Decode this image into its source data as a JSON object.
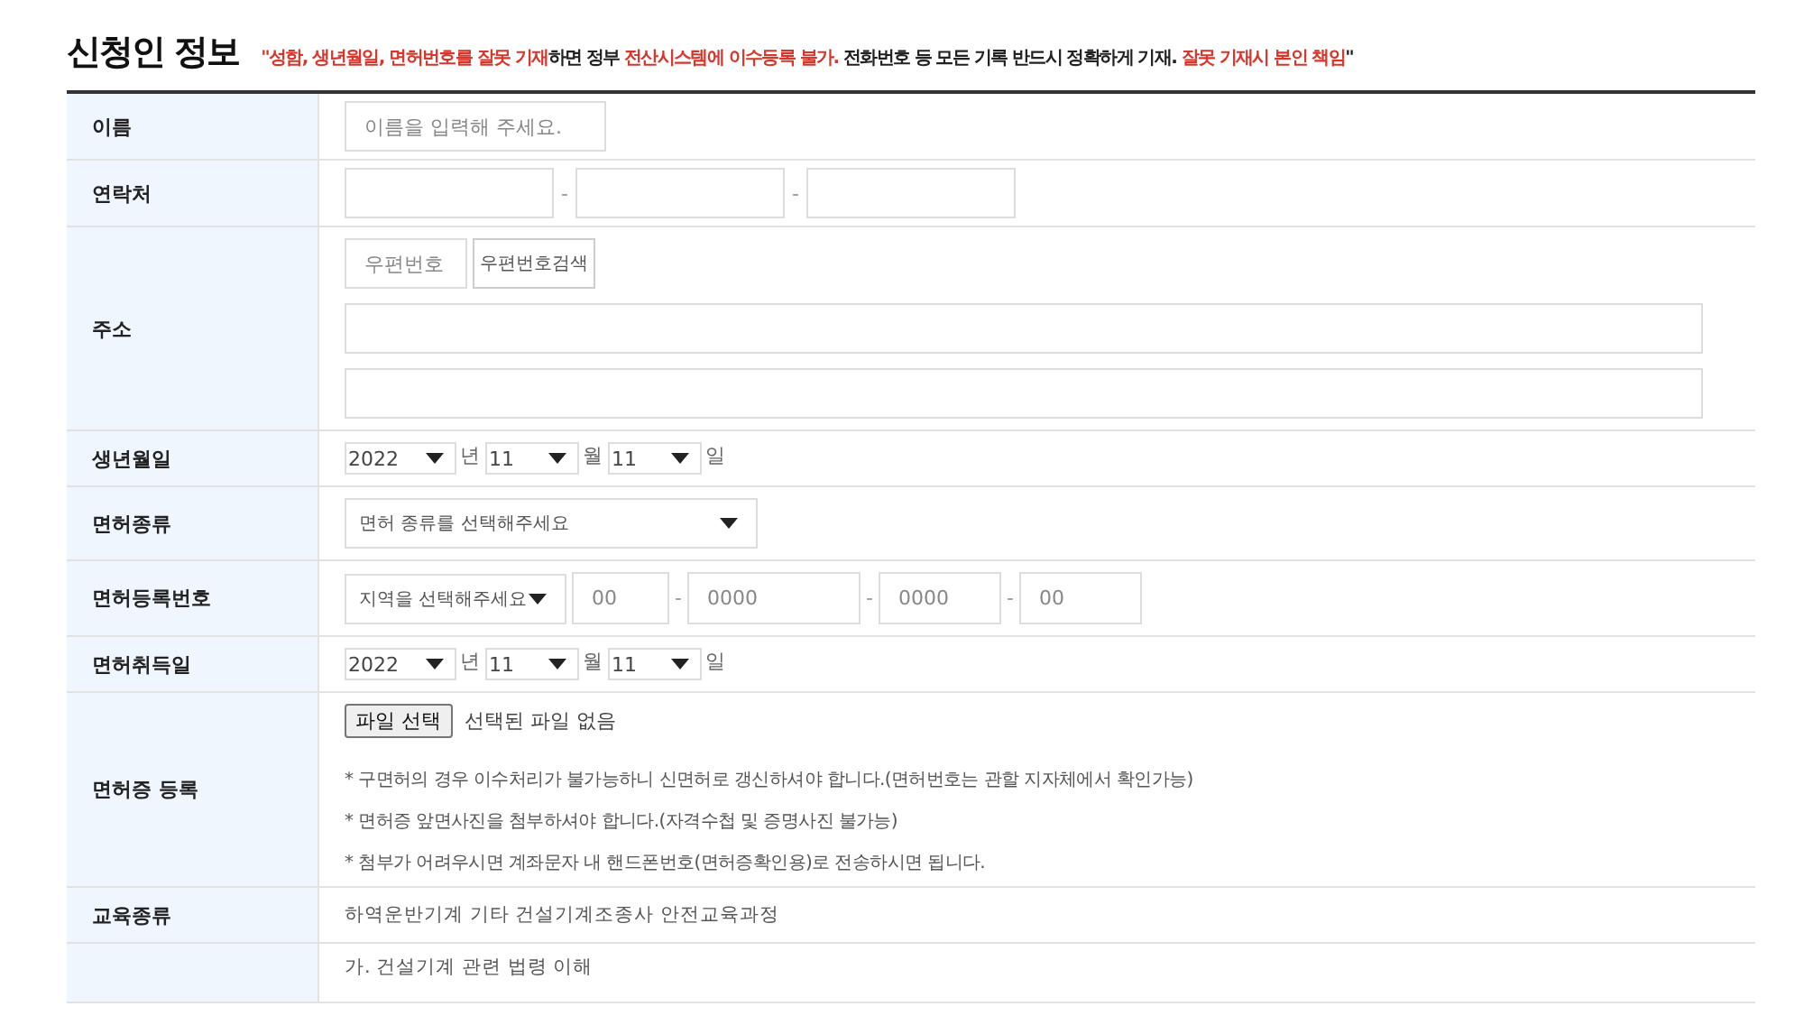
{
  "section": {
    "title": "신청인 정보",
    "notice": [
      {
        "text": "\"성함, 생년월일, 면허번호를 잘못 기재",
        "emphasis": true
      },
      {
        "text": "하면 정부 ",
        "emphasis": false
      },
      {
        "text": "전산시스템에 이수등록 불가.",
        "emphasis": true
      },
      {
        "text": " 전화번호 등 모든 기록 반드시 정확하게 기재. ",
        "emphasis": false
      },
      {
        "text": "잘못 기재시 본인 책임",
        "emphasis": true
      },
      {
        "text": "\"",
        "emphasis": false
      }
    ]
  },
  "rows": [
    {
      "kind": "text",
      "label": "이름",
      "fields": [
        {
          "placeholder": "이름을 입력해 주세요."
        }
      ]
    },
    {
      "kind": "phone",
      "label": "연락처",
      "fields": [
        {
          "kind": "input"
        },
        {
          "kind": "input"
        },
        {
          "kind": "input"
        }
      ],
      "separators": [
        "-",
        "-"
      ]
    },
    {
      "kind": "address",
      "label": "주소",
      "zipcode": {
        "placeholder": "우편번호"
      },
      "search_button": "우편번호검색",
      "lines": [
        {
          "kind": "input"
        },
        {
          "kind": "input"
        }
      ]
    },
    {
      "kind": "date",
      "label": "생년월일",
      "parts": [
        {
          "value": "2022",
          "unit": "년"
        },
        {
          "value": "11",
          "unit": "월"
        },
        {
          "value": "11",
          "unit": "일"
        }
      ]
    },
    {
      "kind": "select",
      "label": "면허종류",
      "value": "면허 종류를 선택해주세요"
    },
    {
      "kind": "license",
      "label": "면허등록번호",
      "region": "지역을 선택해주세요",
      "fields": [
        {
          "placeholder": "00"
        },
        {
          "placeholder": "0000"
        },
        {
          "placeholder": "0000"
        },
        {
          "placeholder": "00"
        }
      ],
      "separators": [
        "-",
        "-",
        "-"
      ]
    },
    {
      "kind": "date",
      "label": "면허취득일",
      "parts": [
        {
          "value": "2022",
          "unit": "년"
        },
        {
          "value": "11",
          "unit": "월"
        },
        {
          "value": "11",
          "unit": "일"
        }
      ]
    },
    {
      "kind": "file",
      "label": "면허증 등록",
      "button": "파일 선택",
      "status": "선택된 파일 없음",
      "notes": [
        "* 구면허의 경우 이수처리가 불가능하니 신면허로 갱신하셔야 합니다.(면허번호는 관할 지자체에서 확인가능)",
        "* 면허증 앞면사진을 첨부하셔야 합니다.(자격수첩 및 증명사진 불가능)",
        "* 첨부가 어려우시면 계좌문자 내 핸드폰번호(면허증확인용)로 전송하시면 됩니다."
      ]
    },
    {
      "kind": "value",
      "label": "교육종류",
      "value": "하역운반기계 기타 건설기계조종사 안전교육과정"
    },
    {
      "kind": "list",
      "items": [
        "가. 건설기계 관련 법령 이해"
      ]
    }
  ]
}
